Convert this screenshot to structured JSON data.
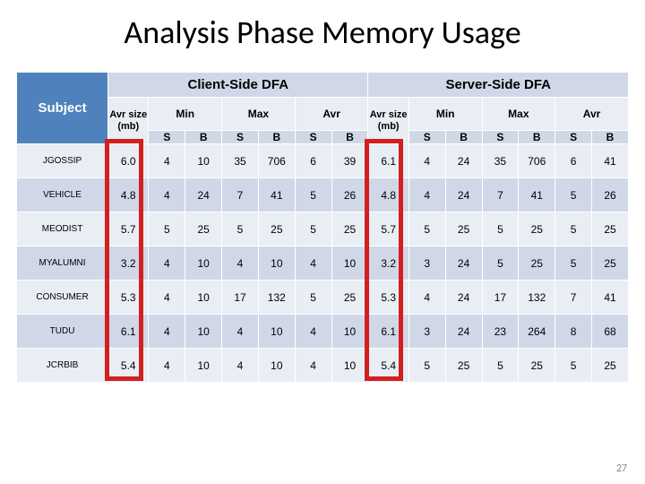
{
  "title": "Analysis Phase Memory Usage",
  "page_number": "27",
  "headers": {
    "subject": "Subject",
    "client_side": "Client-Side DFA",
    "server_side": "Server-Side DFA",
    "avr_size_mb": "Avr size (mb)",
    "min": "Min",
    "max": "Max",
    "avr": "Avr",
    "s": "S",
    "b": "B"
  },
  "rows": [
    {
      "subject": "JGOSSIP",
      "c_avr": "6.0",
      "c_min_s": "4",
      "c_min_b": "10",
      "c_max_s": "35",
      "c_max_b": "706",
      "c_avr_s": "6",
      "c_avr_b": "39",
      "s_avr": "6.1",
      "s_min_s": "4",
      "s_min_b": "24",
      "s_max_s": "35",
      "s_max_b": "706",
      "s_avr_s": "6",
      "s_avr_b": "41"
    },
    {
      "subject": "VEHICLE",
      "c_avr": "4.8",
      "c_min_s": "4",
      "c_min_b": "24",
      "c_max_s": "7",
      "c_max_b": "41",
      "c_avr_s": "5",
      "c_avr_b": "26",
      "s_avr": "4.8",
      "s_min_s": "4",
      "s_min_b": "24",
      "s_max_s": "7",
      "s_max_b": "41",
      "s_avr_s": "5",
      "s_avr_b": "26"
    },
    {
      "subject": "MEODIST",
      "c_avr": "5.7",
      "c_min_s": "5",
      "c_min_b": "25",
      "c_max_s": "5",
      "c_max_b": "25",
      "c_avr_s": "5",
      "c_avr_b": "25",
      "s_avr": "5.7",
      "s_min_s": "5",
      "s_min_b": "25",
      "s_max_s": "5",
      "s_max_b": "25",
      "s_avr_s": "5",
      "s_avr_b": "25"
    },
    {
      "subject": "MYALUMNI",
      "c_avr": "3.2",
      "c_min_s": "4",
      "c_min_b": "10",
      "c_max_s": "4",
      "c_max_b": "10",
      "c_avr_s": "4",
      "c_avr_b": "10",
      "s_avr": "3.2",
      "s_min_s": "3",
      "s_min_b": "24",
      "s_max_s": "5",
      "s_max_b": "25",
      "s_avr_s": "5",
      "s_avr_b": "25"
    },
    {
      "subject": "CONSUMER",
      "c_avr": "5.3",
      "c_min_s": "4",
      "c_min_b": "10",
      "c_max_s": "17",
      "c_max_b": "132",
      "c_avr_s": "5",
      "c_avr_b": "25",
      "s_avr": "5.3",
      "s_min_s": "4",
      "s_min_b": "24",
      "s_max_s": "17",
      "s_max_b": "132",
      "s_avr_s": "7",
      "s_avr_b": "41"
    },
    {
      "subject": "TUDU",
      "c_avr": "6.1",
      "c_min_s": "4",
      "c_min_b": "10",
      "c_max_s": "4",
      "c_max_b": "10",
      "c_avr_s": "4",
      "c_avr_b": "10",
      "s_avr": "6.1",
      "s_min_s": "3",
      "s_min_b": "24",
      "s_max_s": "23",
      "s_max_b": "264",
      "s_avr_s": "8",
      "s_avr_b": "68"
    },
    {
      "subject": "JCRBIB",
      "c_avr": "5.4",
      "c_min_s": "4",
      "c_min_b": "10",
      "c_max_s": "4",
      "c_max_b": "10",
      "c_avr_s": "4",
      "c_avr_b": "10",
      "s_avr": "5.4",
      "s_min_s": "5",
      "s_min_b": "25",
      "s_max_s": "5",
      "s_max_b": "25",
      "s_avr_s": "5",
      "s_avr_b": "25"
    }
  ]
}
